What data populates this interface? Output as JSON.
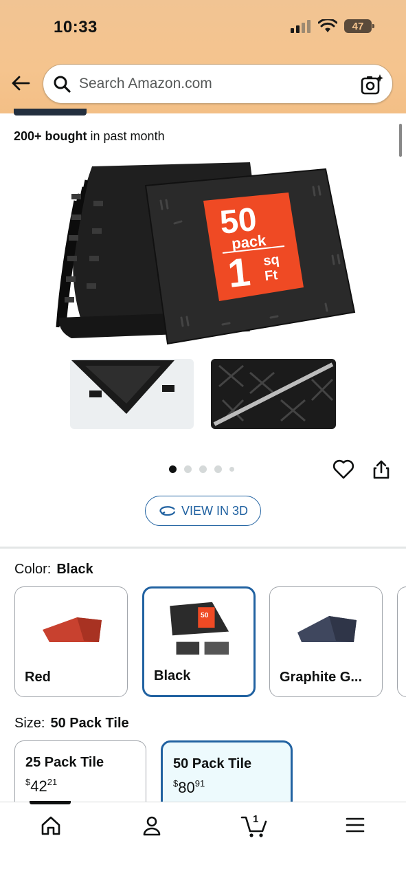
{
  "status_bar": {
    "time": "10:33",
    "battery": "47"
  },
  "search": {
    "placeholder": "Search Amazon.com"
  },
  "product": {
    "bought_count": "200+ bought",
    "bought_suffix": " in past month",
    "image_overlay": {
      "big_number": "50",
      "pack_word": "pack",
      "one": "1",
      "sq": "sq",
      "ft": "Ft"
    },
    "carousel": {
      "total": 5,
      "active_index": 0
    },
    "view_3d_label": "VIEW IN 3D"
  },
  "color_selector": {
    "label": "Color:",
    "selected": "Black",
    "options": [
      {
        "name": "Red",
        "color": "#c8412f"
      },
      {
        "name": "Black",
        "color": "#2b2b2b",
        "badge": "50"
      },
      {
        "name": "Graphite G...",
        "color": "#3f475e"
      }
    ]
  },
  "size_selector": {
    "label": "Size:",
    "selected": "50 Pack Tile",
    "options": [
      {
        "name": "25 Pack Tile",
        "currency": "$",
        "whole": "42",
        "fraction": "21"
      },
      {
        "name": "50 Pack Tile",
        "currency": "$",
        "whole": "80",
        "fraction": "91"
      }
    ]
  },
  "bottom_nav": {
    "cart_count": "1",
    "items": [
      "home-icon",
      "account-icon",
      "cart-icon",
      "menu-icon"
    ]
  }
}
